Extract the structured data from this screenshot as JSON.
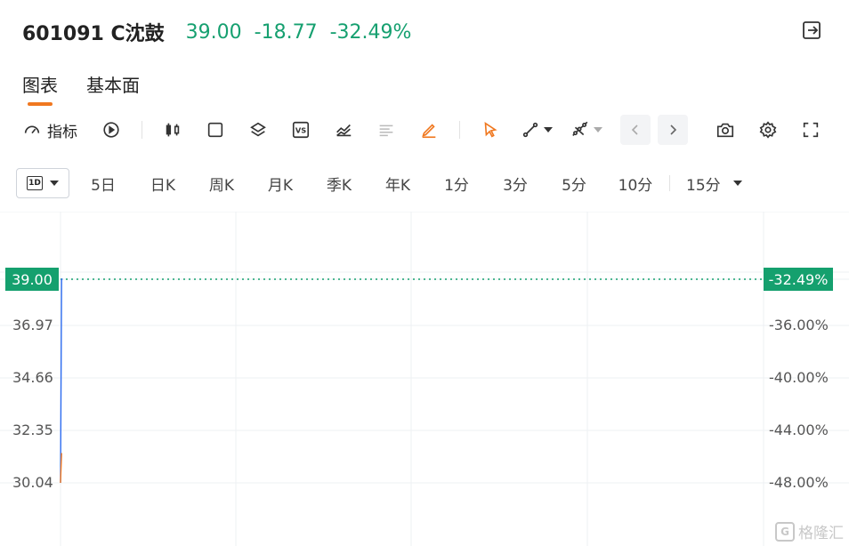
{
  "header": {
    "symbol": "601091 C沈鼓",
    "price": "39.00",
    "change": "-18.77",
    "change_pct": "-32.49%",
    "quote_color": "#16a070",
    "exit_icon": "exit-fullscreen-icon"
  },
  "tabs": [
    {
      "label": "图表",
      "active": true
    },
    {
      "label": "基本面",
      "active": false
    }
  ],
  "toolbar": {
    "indicator_label": "指标",
    "icons": [
      "gauge-icon",
      "replay-icon",
      "candlestick-icon",
      "rectangle-icon",
      "layers-icon",
      "vs-compare-icon",
      "trend-chart-icon",
      "align-lines-icon",
      "pen-icon",
      "cursor-icon",
      "line-tool-icon",
      "multi-line-tool-icon",
      "chevron-left-icon",
      "chevron-right-icon",
      "camera-icon",
      "gear-icon",
      "fullscreen-icon"
    ],
    "accent_color": "#f07820"
  },
  "periods": {
    "selected_icon_text": "1D",
    "items": [
      "5日",
      "日K",
      "周K",
      "月K",
      "季K",
      "年K",
      "1分",
      "3分",
      "5分",
      "10分"
    ],
    "dropdown_label": "15分"
  },
  "chart_data": {
    "type": "line",
    "y_left_ticks": [
      "39.00",
      "36.97",
      "34.66",
      "32.35",
      "30.04"
    ],
    "y_right_ticks": [
      "-32.49%",
      "-36.00%",
      "-40.00%",
      "-44.00%",
      "-48.00%"
    ],
    "last_price": 39.0,
    "last_pct": "-32.49%",
    "series": [
      {
        "color": "#2d6cf0",
        "x": [
          0,
          1,
          2
        ],
        "y": [
          30.04,
          39.0,
          39.0
        ]
      },
      {
        "color": "#f07820",
        "x": [
          0,
          1
        ],
        "y": [
          30.04,
          31.35
        ]
      }
    ],
    "ylim": [
      28.5,
      40.2
    ],
    "grid": true,
    "price_tag_color": "#15a06e"
  },
  "watermark": "格隆汇"
}
